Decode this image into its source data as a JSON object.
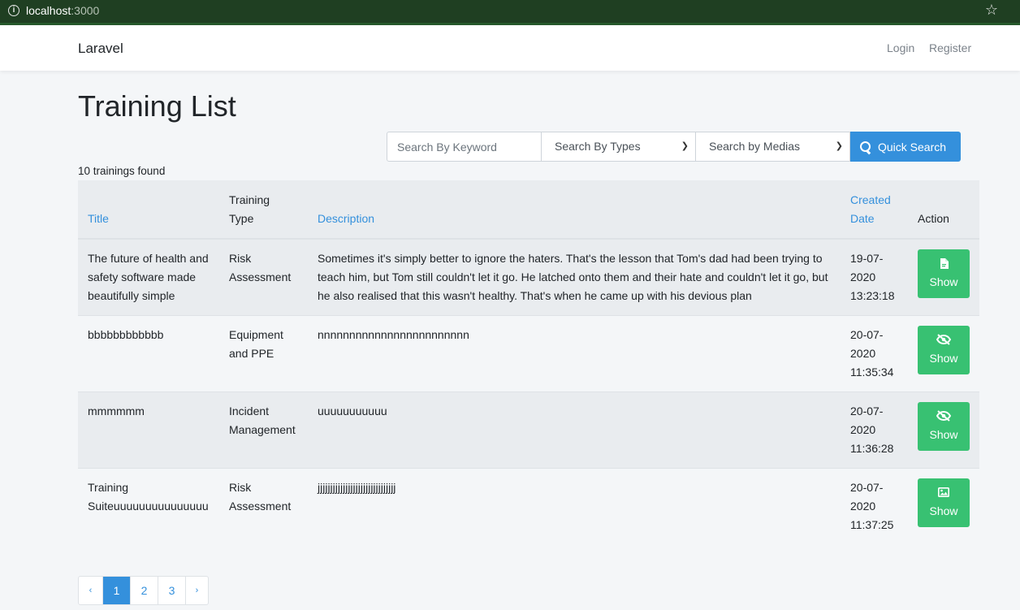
{
  "browser": {
    "host": "localhost",
    "port": ":3000"
  },
  "navbar": {
    "brand": "Laravel",
    "login": "Login",
    "register": "Register"
  },
  "page": {
    "title": "Training List",
    "results_count": "10 trainings found"
  },
  "search": {
    "keyword_placeholder": "Search By Keyword",
    "types_selected": "Search By Types",
    "medias_selected": "Search by Medias",
    "button_label": "Quick Search"
  },
  "table": {
    "headers": {
      "title": "Title",
      "type_line1": "Training",
      "type_line2": "Type",
      "description": "Description",
      "date_line1": "Created",
      "date_line2": "Date",
      "action": "Action"
    },
    "rows": [
      {
        "title": "The future of health and safety software made beautifully simple",
        "type": "Risk Assessment",
        "description": "Sometimes it's simply better to ignore the haters. That's the lesson that Tom's dad had been trying to teach him, but Tom still couldn't let it go. He latched onto them and their hate and couldn't let it go, but he also realised that this wasn't healthy. That's when he came up with his devious plan",
        "date_line1": "19-07-",
        "date_line2": "2020",
        "date_line3": "13:23:18",
        "action_label": "Show",
        "action_icon": "pdf-file-icon"
      },
      {
        "title": "bbbbbbbbbbbb",
        "type": "Equipment and PPE",
        "description": "nnnnnnnnnnnnnnnnnnnnnnnn",
        "date_line1": "20-07-",
        "date_line2": "2020",
        "date_line3": "11:35:34",
        "action_label": "Show",
        "action_icon": "eye-slash-icon"
      },
      {
        "title": "mmmmmm",
        "type": "Incident Management",
        "description": "uuuuuuuuuuu",
        "date_line1": "20-07-",
        "date_line2": "2020",
        "date_line3": "11:36:28",
        "action_label": "Show",
        "action_icon": "eye-slash-icon"
      },
      {
        "title": "Training Suiteuuuuuuuuuuuuuuu",
        "type": "Risk Assessment",
        "description": "jjjjjjjjjjjjjjjjjjjjjjjjjjjjjjj",
        "date_line1": "20-07-",
        "date_line2": "2020",
        "date_line3": "11:37:25",
        "action_label": "Show",
        "action_icon": "image-icon"
      }
    ]
  },
  "pagination": {
    "prev": "‹",
    "pages": [
      "1",
      "2",
      "3"
    ],
    "next": "›",
    "active": "1"
  },
  "colors": {
    "primary": "#3490dc",
    "success": "#38c172",
    "browser_bar": "#1f3f22"
  }
}
